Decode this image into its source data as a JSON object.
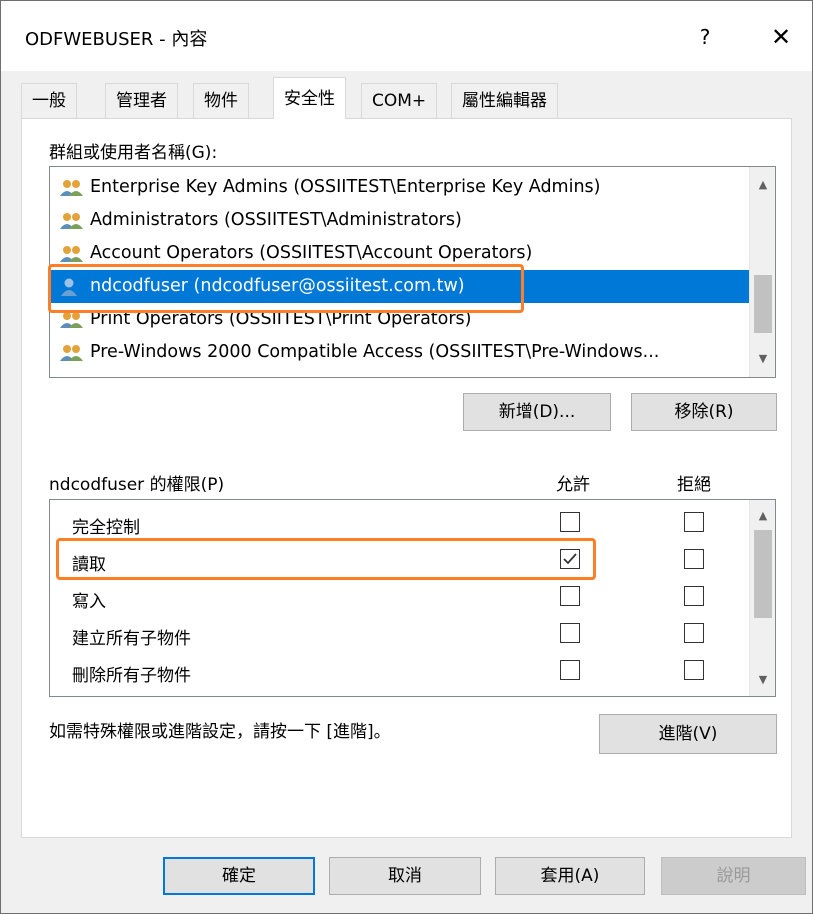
{
  "window": {
    "title": "ODFWEBUSER - 內容",
    "help_label": "?",
    "close_label": "✕"
  },
  "tabs": [
    {
      "label": "一般",
      "active": false
    },
    {
      "label": "管理者",
      "active": false
    },
    {
      "label": "物件",
      "active": false
    },
    {
      "label": "安全性",
      "active": true
    },
    {
      "label": "COM+",
      "active": false
    },
    {
      "label": "屬性編輯器",
      "active": false
    }
  ],
  "groups": {
    "label": "群組或使用者名稱(G):",
    "items": [
      {
        "text": "Enterprise Key Admins (OSSIITEST\\Enterprise Key Admins)",
        "icon": "group-icon",
        "selected": false
      },
      {
        "text": "Administrators (OSSIITEST\\Administrators)",
        "icon": "group-icon",
        "selected": false
      },
      {
        "text": "Account Operators (OSSIITEST\\Account Operators)",
        "icon": "group-icon",
        "selected": false
      },
      {
        "text": "ndcodfuser (ndcodfuser@ossiitest.com.tw)",
        "icon": "user-icon",
        "selected": true
      },
      {
        "text": "Print Operators (OSSIITEST\\Print Operators)",
        "icon": "group-icon",
        "selected": false
      },
      {
        "text": "Pre-Windows 2000 Compatible Access (OSSIITEST\\Pre-Windows...",
        "icon": "group-icon",
        "selected": false
      }
    ],
    "add_label": "新增(D)...",
    "remove_label": "移除(R)"
  },
  "permissions": {
    "label": "ndcodfuser 的權限(P)",
    "allow_header": "允許",
    "deny_header": "拒絕",
    "items": [
      {
        "name": "完全控制",
        "allow": false,
        "deny": false
      },
      {
        "name": "讀取",
        "allow": true,
        "deny": false
      },
      {
        "name": "寫入",
        "allow": false,
        "deny": false
      },
      {
        "name": "建立所有子物件",
        "allow": false,
        "deny": false
      },
      {
        "name": "刪除所有子物件",
        "allow": false,
        "deny": false
      }
    ]
  },
  "advanced": {
    "hint": "如需特殊權限或進階設定，請按一下 [進階]。",
    "button_label": "進階(V)"
  },
  "footer": {
    "ok_label": "確定",
    "cancel_label": "取消",
    "apply_label": "套用(A)",
    "help_label": "說明"
  },
  "colors": {
    "selection": "#0078d7",
    "highlight": "#ff7f27",
    "group_icon_primary": "#5b8fb9",
    "group_icon_secondary": "#e3a33a"
  }
}
